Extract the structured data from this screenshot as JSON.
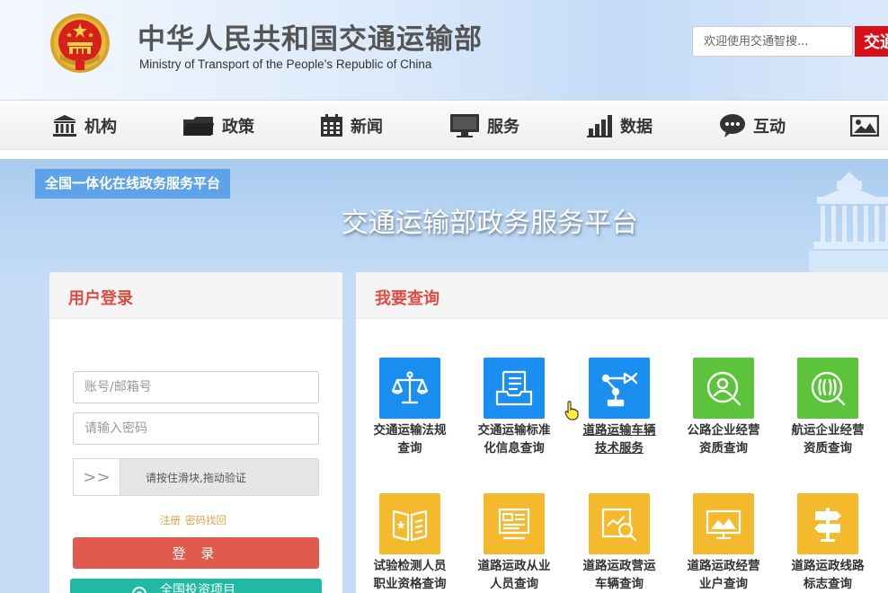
{
  "header": {
    "title_cn": "中华人民共和国交通运输部",
    "title_en": "Ministry of Transport of the People’s Republic of China",
    "search_placeholder": "欢迎使用交通智搜...",
    "search_button": "交通",
    "emblem": "national-emblem"
  },
  "nav": [
    {
      "label": "机构",
      "icon": "institution-icon"
    },
    {
      "label": "政策",
      "icon": "folder-icon"
    },
    {
      "label": "新闻",
      "icon": "calendar-icon"
    },
    {
      "label": "服务",
      "icon": "monitor-icon"
    },
    {
      "label": "数据",
      "icon": "bar-chart-icon"
    },
    {
      "label": "互动",
      "icon": "speech-bubble-icon"
    },
    {
      "label": "",
      "icon": "image-icon"
    }
  ],
  "banner": {
    "tag": "全国一体化在线政务服务平台",
    "title": "交通运输部政务服务平台"
  },
  "login": {
    "title": "用户登录",
    "account_placeholder": "账号/邮箱号",
    "password_placeholder": "请输入密码",
    "slider_arrow": ">>",
    "slider_text": "请按住滑块,拖动验证",
    "register": "注册",
    "forgot": "密码找回",
    "login_button": "登 录",
    "invest_button": "全国投资项目"
  },
  "query": {
    "title": "我要查询",
    "tiles": [
      {
        "line1": "交通运输法规",
        "line2": "查询",
        "color": "#1b8ef2",
        "icon": "scales-icon"
      },
      {
        "line1": "交通运输标准",
        "line2": "化信息查询",
        "color": "#1b8ef2",
        "icon": "document-tray-icon"
      },
      {
        "line1": "道路运输车辆",
        "line2": "技术服务",
        "color": "#1b8ef2",
        "icon": "robot-arm-icon"
      },
      {
        "line1": "公路企业经营",
        "line2": "资质查询",
        "color": "#5cc43a",
        "icon": "person-search-icon"
      },
      {
        "line1": "航运企业经营",
        "line2": "资质查询",
        "color": "#5cc43a",
        "icon": "wave-search-icon"
      },
      {
        "line1": "试验检测人员",
        "line2": "职业资格查询",
        "color": "#f4b92d",
        "icon": "star-book-icon"
      },
      {
        "line1": "道路运政从业",
        "line2": "人员查询",
        "color": "#f4b92d",
        "icon": "id-card-icon"
      },
      {
        "line1": "道路运政营运",
        "line2": "车辆查询",
        "color": "#f4b92d",
        "icon": "vehicle-search-icon"
      },
      {
        "line1": "道路运政经营",
        "line2": "业户查询",
        "color": "#f4b92d",
        "icon": "landscape-frame-icon"
      },
      {
        "line1": "道路运政线路",
        "line2": "标志查询",
        "color": "#f4b92d",
        "icon": "signpost-icon"
      }
    ]
  }
}
